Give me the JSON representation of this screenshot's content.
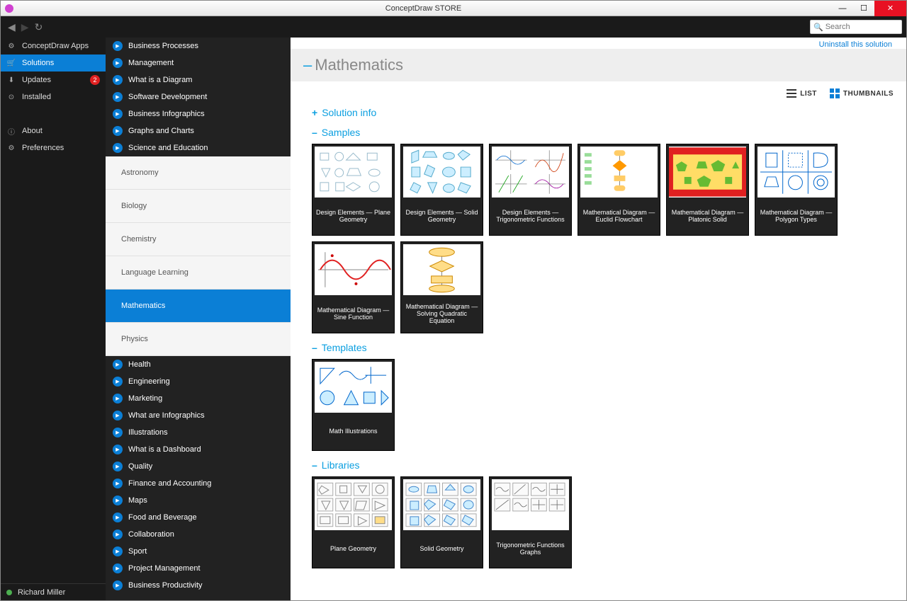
{
  "titlebar": {
    "title": "ConceptDraw STORE"
  },
  "toolbar": {
    "search_placeholder": "Search"
  },
  "nav": {
    "items": [
      {
        "label": "ConceptDraw Apps",
        "icon": "apps"
      },
      {
        "label": "Solutions",
        "icon": "cart",
        "selected": true
      },
      {
        "label": "Updates",
        "icon": "download",
        "badge": "2"
      },
      {
        "label": "Installed",
        "icon": "installed"
      }
    ],
    "items2": [
      {
        "label": "About",
        "icon": "info"
      },
      {
        "label": "Preferences",
        "icon": "gear"
      }
    ],
    "user": "Richard Miller"
  },
  "tree": {
    "items": [
      {
        "type": "cat",
        "label": "Business Processes"
      },
      {
        "type": "cat",
        "label": "Management"
      },
      {
        "type": "cat",
        "label": "What is a Diagram"
      },
      {
        "type": "cat",
        "label": "Software Development"
      },
      {
        "type": "cat",
        "label": "Business Infographics"
      },
      {
        "type": "cat",
        "label": "Graphs and Charts"
      },
      {
        "type": "cat",
        "label": "Science and Education"
      },
      {
        "type": "sub",
        "label": "Astronomy"
      },
      {
        "type": "sub",
        "label": "Biology"
      },
      {
        "type": "sub",
        "label": "Chemistry"
      },
      {
        "type": "sub",
        "label": "Language Learning"
      },
      {
        "type": "sub",
        "label": "Mathematics",
        "selected": true
      },
      {
        "type": "sub",
        "label": "Physics"
      },
      {
        "type": "cat",
        "label": "Health"
      },
      {
        "type": "cat",
        "label": "Engineering"
      },
      {
        "type": "cat",
        "label": "Marketing"
      },
      {
        "type": "cat",
        "label": "What are Infographics"
      },
      {
        "type": "cat",
        "label": "Illustrations"
      },
      {
        "type": "cat",
        "label": "What is a Dashboard"
      },
      {
        "type": "cat",
        "label": "Quality"
      },
      {
        "type": "cat",
        "label": "Finance and Accounting"
      },
      {
        "type": "cat",
        "label": "Maps"
      },
      {
        "type": "cat",
        "label": "Food and Beverage"
      },
      {
        "type": "cat",
        "label": "Collaboration"
      },
      {
        "type": "cat",
        "label": "Sport"
      },
      {
        "type": "cat",
        "label": "Project Management"
      },
      {
        "type": "cat",
        "label": "Business Productivity"
      }
    ]
  },
  "content": {
    "uninstall": "Uninstall this solution",
    "title": "Mathematics",
    "view_list": "LIST",
    "view_thumb": "THUMBNAILS",
    "sections": {
      "solution_info": "Solution info",
      "samples": "Samples",
      "templates": "Templates",
      "libraries": "Libraries"
    },
    "samples": [
      {
        "label": "Design Elements — Plane Geometry",
        "thumb": "plane"
      },
      {
        "label": "Design Elements — Solid Geometry",
        "thumb": "solid"
      },
      {
        "label": "Design Elements — Trigonometric Functions",
        "thumb": "trig"
      },
      {
        "label": "Mathematical Diagram — Euclid Flowchart",
        "thumb": "flow"
      },
      {
        "label": "Mathematical Diagram — Platonic Solid",
        "thumb": "red"
      },
      {
        "label": "Mathematical Diagram — Polygon Types",
        "thumb": "poly"
      },
      {
        "label": "Mathematical Diagram — Sine Function",
        "thumb": "sine"
      },
      {
        "label": "Mathematical Diagram — Solving Quadratic Equation",
        "thumb": "quad"
      }
    ],
    "templates": [
      {
        "label": "Math Illustrations",
        "thumb": "math"
      }
    ],
    "libraries": [
      {
        "label": "Plane Geometry",
        "thumb": "libplane"
      },
      {
        "label": "Solid Geometry",
        "thumb": "libsolid"
      },
      {
        "label": "Trigonometric Functions Graphs",
        "thumb": "libtrig"
      }
    ]
  }
}
